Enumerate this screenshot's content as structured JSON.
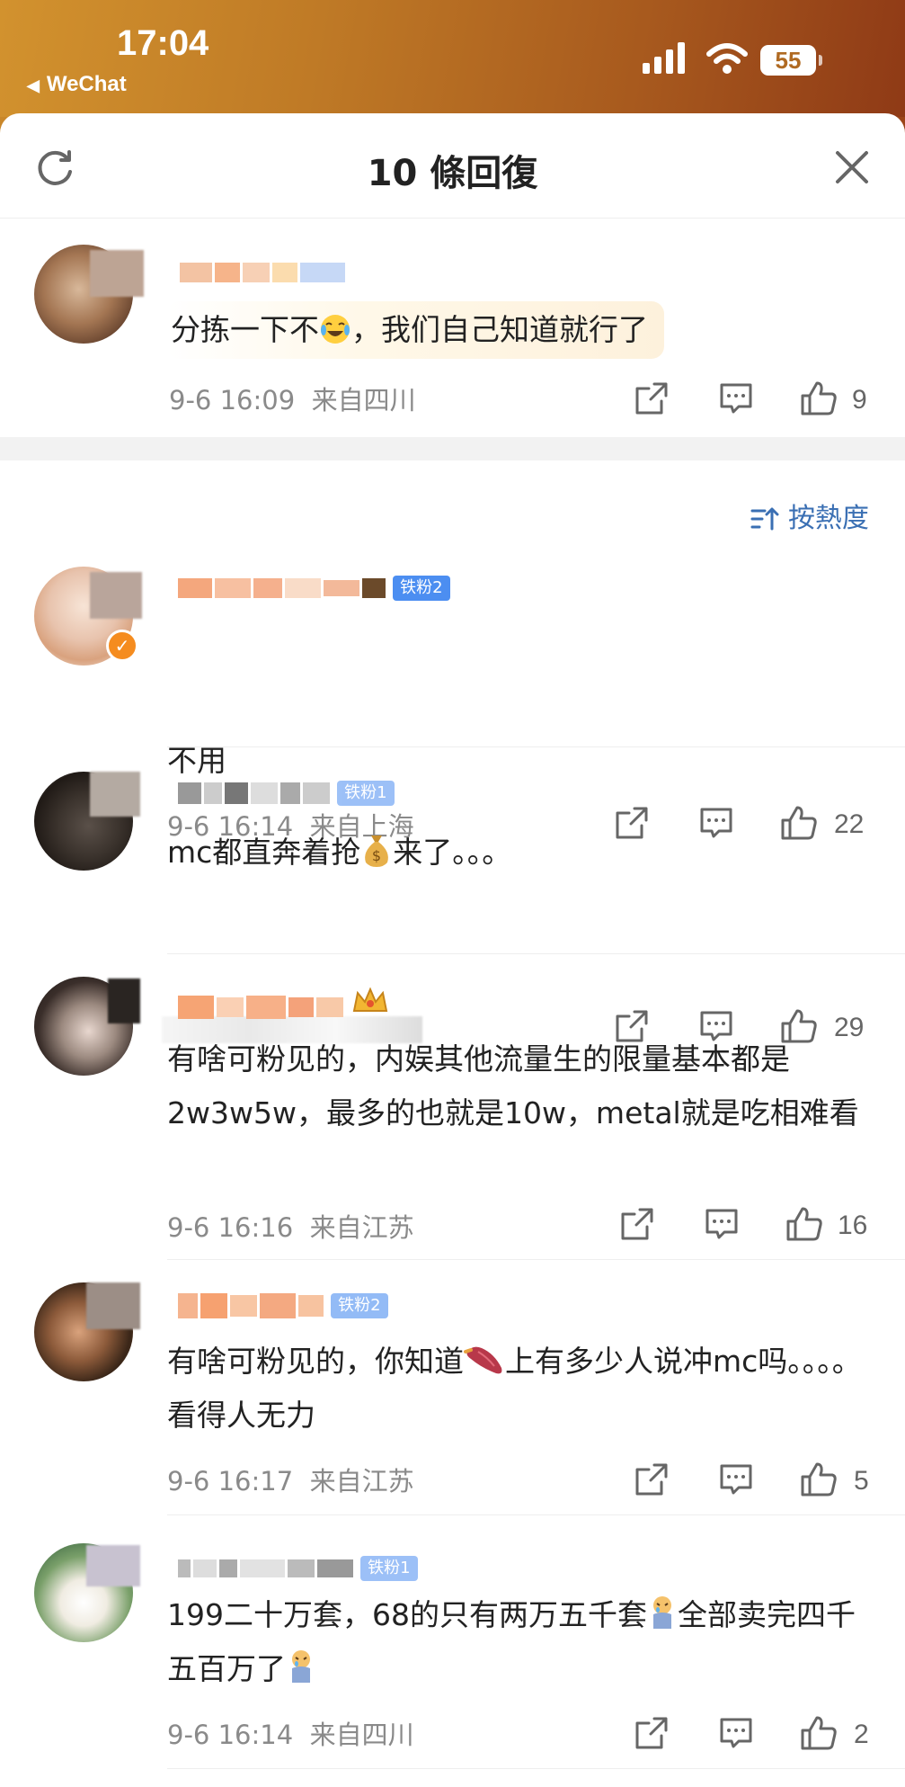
{
  "status_bar": {
    "time": "17:04",
    "back_label": "WeChat",
    "battery": "55"
  },
  "sheet": {
    "title": "10 條回復",
    "sort_label": "按熱度"
  },
  "original_comment": {
    "text_before": "分拣一下不",
    "text_after": "，我们自己知道就行了",
    "time": "9-6 16:09",
    "location": "来自四川",
    "likes": "9"
  },
  "replies": [
    {
      "badge": "铁粉2",
      "text": "不用",
      "time": "9-6 16:14",
      "location": "来自上海",
      "likes": "22"
    },
    {
      "badge": "铁粉1",
      "text_before": "mc都直奔着抢",
      "text_after": "来了。。。",
      "likes": "29"
    },
    {
      "text": "有啥可粉见的，内娱其他流量生的限量基本都是2w3w5w，最多的也就是10w，metal就是吃相难看",
      "time": "9-6 16:16",
      "location": "来自江苏",
      "likes": "16"
    },
    {
      "badge": "铁粉2",
      "text_before": "有啥可粉见的，你知道",
      "text_after": "上有多少人说冲mc吗。。。。看得人无力",
      "time": "9-6 16:17",
      "location": "来自江苏",
      "likes": "5"
    },
    {
      "badge": "铁粉1",
      "text_before": "199二十万套，68的只有两万五千套",
      "text_mid": "全部卖完四千五百万了",
      "time": "9-6 16:14",
      "location": "来自四川",
      "likes": "2"
    }
  ],
  "icons": [
    "refresh-icon",
    "close-icon",
    "share-icon",
    "comment-icon",
    "like-icon",
    "sort-icon",
    "laugh-cry-emoji",
    "money-bag-emoji",
    "sweet-potato-emoji",
    "crying-emoji"
  ],
  "colors": {
    "accent_blue": "#3a6fb3",
    "badge_blue": "#4c8ef1",
    "status_orange": "#bf7a26"
  }
}
